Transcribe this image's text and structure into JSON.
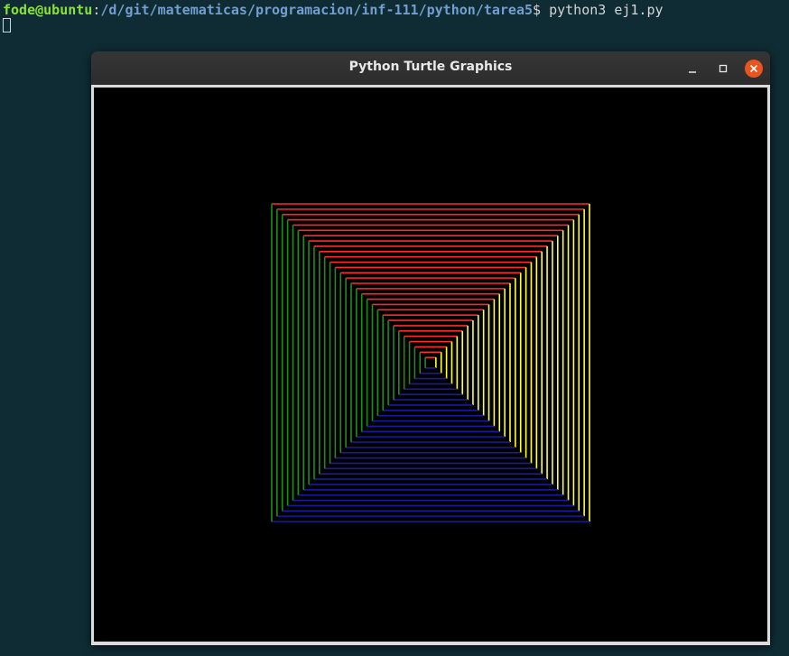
{
  "terminal": {
    "user_host": "fode@ubuntu",
    "separator": ":",
    "path": "/d/git/matematicas/programacion/inf-111/python/tarea5",
    "prompt_symbol": "$",
    "command": " python3 ej1.py"
  },
  "window": {
    "title": "Python Turtle Graphics",
    "buttons": {
      "minimize": "minimize-icon",
      "maximize": "maximize-icon",
      "close": "close-icon"
    },
    "close_color": "#e95420"
  },
  "drawing": {
    "background": "#000000",
    "colors": {
      "top": "#ff2a2a",
      "right": "#ffff33",
      "bottom": "#1a1aa0",
      "left": "#1e8c1e"
    },
    "square_count": 30
  }
}
